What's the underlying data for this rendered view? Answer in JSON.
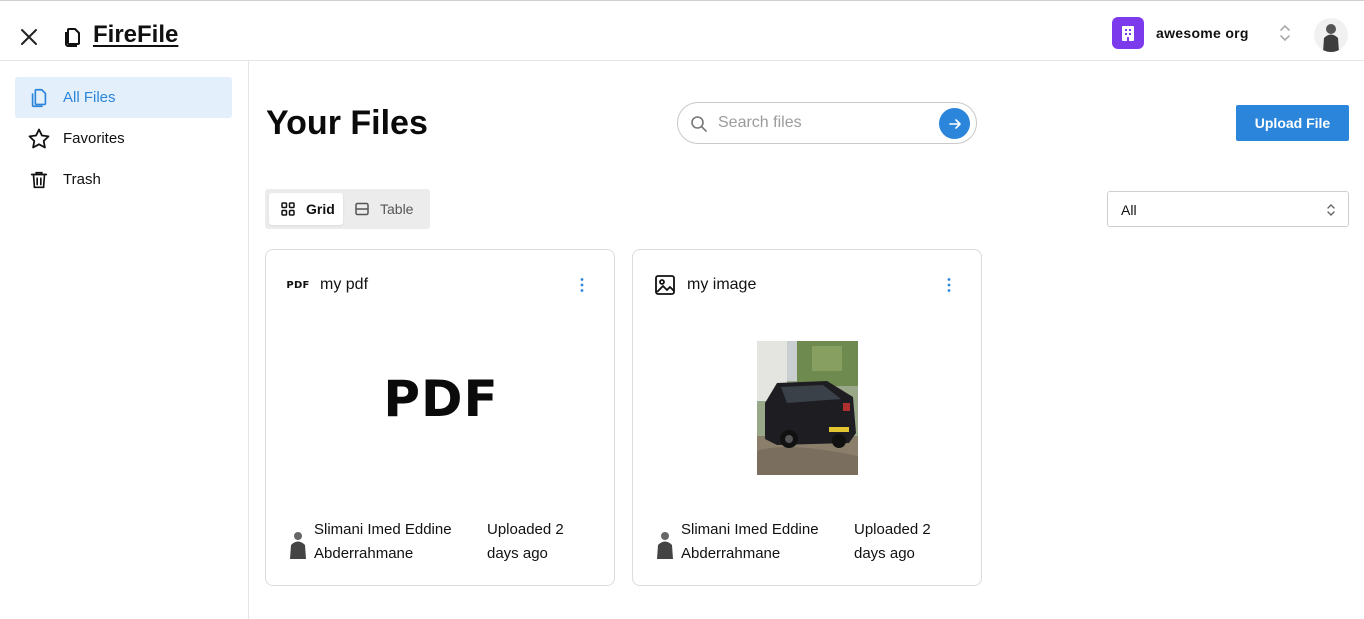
{
  "header": {
    "brand": "FireFile",
    "org": {
      "name": "awesome org",
      "color": "#7c3aed"
    }
  },
  "sidebar": {
    "items": [
      {
        "label": "All Files",
        "icon": "files-icon",
        "active": true
      },
      {
        "label": "Favorites",
        "icon": "star-icon",
        "active": false
      },
      {
        "label": "Trash",
        "icon": "trash-icon",
        "active": false
      }
    ]
  },
  "main": {
    "title": "Your Files",
    "search": {
      "placeholder": "Search files",
      "value": ""
    },
    "upload_label": "Upload File",
    "view_toggle": {
      "grid_label": "Grid",
      "table_label": "Table",
      "selected": "Grid"
    },
    "filter": {
      "value": "All"
    },
    "files": [
      {
        "title": "my pdf",
        "type": "pdf",
        "type_icon_text": "PDF",
        "preview_text": "PDF",
        "owner": "Slimani Imed Eddine Abderrahmane",
        "uploaded": "Uploaded 2 days ago"
      },
      {
        "title": "my image",
        "type": "image",
        "type_icon": "image-icon",
        "owner": "Slimani Imed Eddine Abderrahmane",
        "uploaded": "Uploaded 2 days ago"
      }
    ]
  },
  "colors": {
    "accent": "#2b86db",
    "active_bg": "#e3effb",
    "org_purple": "#7c3aed"
  }
}
